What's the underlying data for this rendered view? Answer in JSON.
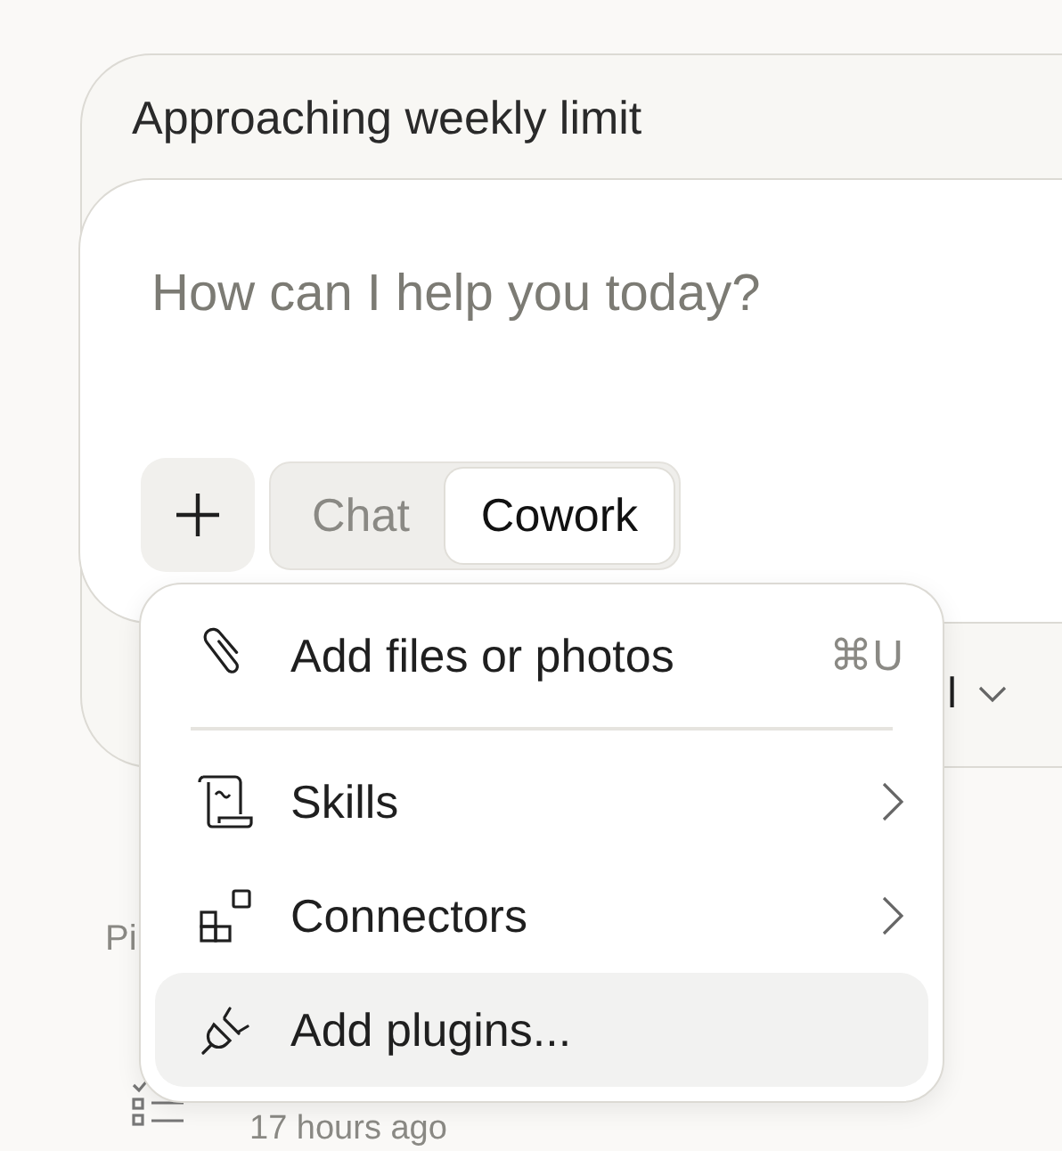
{
  "banner": {
    "title": "Approaching weekly limit"
  },
  "composer": {
    "placeholder": "How can I help you today?",
    "modes": [
      {
        "label": "Chat",
        "selected": false
      },
      {
        "label": "Cowork",
        "selected": true
      }
    ],
    "model_label": "l"
  },
  "section_label": "Pi",
  "task": {
    "time": "17 hours ago"
  },
  "menu": {
    "groups": [
      {
        "items": [
          {
            "label": "Add files or photos",
            "shortcut": "⌘U",
            "submenu": false,
            "highlighted": false
          }
        ]
      },
      {
        "items": [
          {
            "label": "Skills",
            "submenu": true,
            "highlighted": false
          },
          {
            "label": "Connectors",
            "submenu": true,
            "highlighted": false
          },
          {
            "label": "Add plugins...",
            "submenu": false,
            "highlighted": true
          }
        ]
      }
    ]
  }
}
